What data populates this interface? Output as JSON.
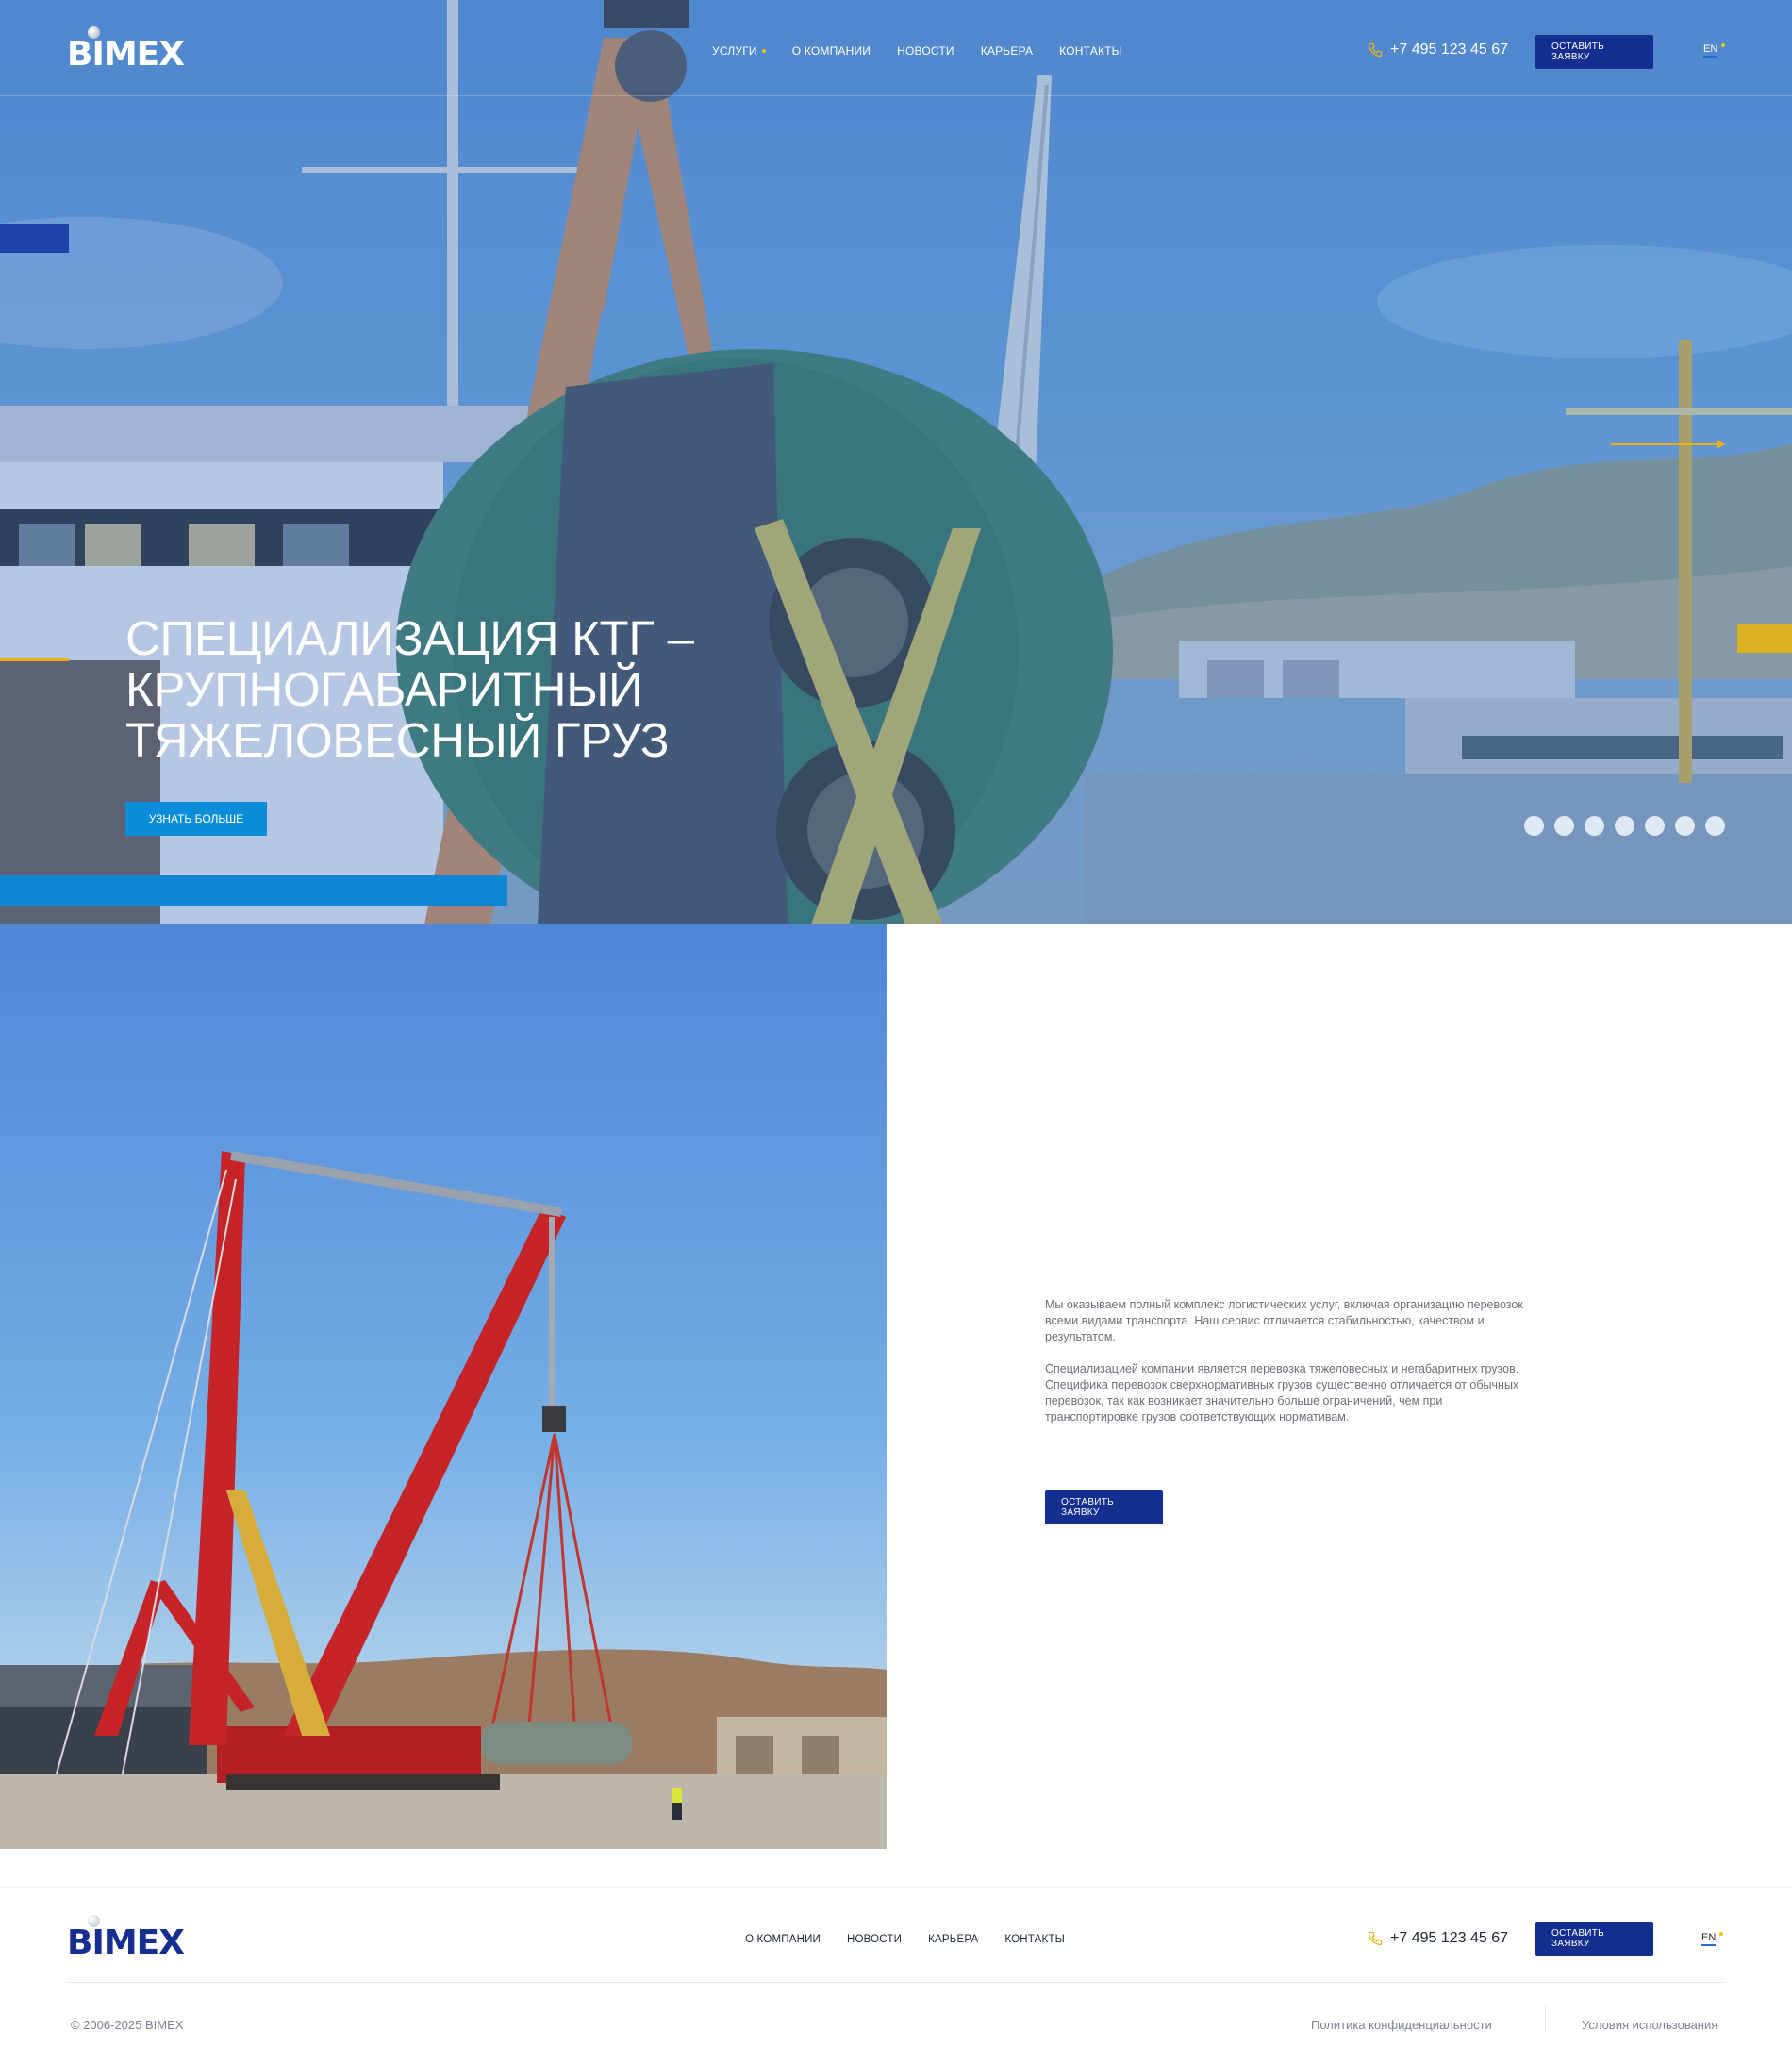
{
  "header": {
    "logo": "BIMEX",
    "nav": [
      {
        "label": "УСЛУГИ",
        "has_dropdown": true
      },
      {
        "label": "О КОМПАНИИ"
      },
      {
        "label": "НОВОСТИ"
      },
      {
        "label": "КАРЬЕРА"
      },
      {
        "label": "КОНТАКТЫ"
      }
    ],
    "phone": "+7 495 123 45 67",
    "cta_label": "ОСТАВИТЬ ЗАЯВКУ",
    "lang": "EN"
  },
  "hero": {
    "title_lines": [
      "СПЕЦИАЛИЗАЦИЯ КТГ –",
      "КРУПНОГАБАРИТНЫЙ",
      "ТЯЖЕЛОВЕСНЫЙ ГРУЗ"
    ],
    "button_label": "УЗНАТЬ БОЛЬШЕ",
    "slide_count": 7
  },
  "about": {
    "paragraphs": [
      "Мы оказываем полный комплекс логистических услуг, включая организацию перевозок всеми видами транспорта. Наш сервис отличается стабильностью, качеством и результатом.",
      "Специализацией компании является перевозка тяжеловесных и негабаритных грузов. Специфика перевозок сверхнормативных грузов существенно отличается от обычных перевозок, так как возникает значительно больше ограничений, чем при транспортировке грузов соответствующих нормативам."
    ],
    "cta_label": "ОСТАВИТЬ ЗАЯВКУ"
  },
  "footer": {
    "logo": "BIMEX",
    "nav": [
      "О КОМПАНИИ",
      "НОВОСТИ",
      "КАРЬЕРА",
      "КОНТАКТЫ"
    ],
    "phone": "+7 495 123 45 67",
    "cta_label": "ОСТАВИТЬ ЗАЯВКУ",
    "lang": "EN",
    "copyright": "© 2006-2025 BIMEX",
    "privacy": "Политика конфиденциальности",
    "terms": "Условия использования"
  },
  "colors": {
    "brand_navy": "#142f8f",
    "accent_yellow": "#f4c000",
    "accent_blue": "#0a8ed9"
  }
}
